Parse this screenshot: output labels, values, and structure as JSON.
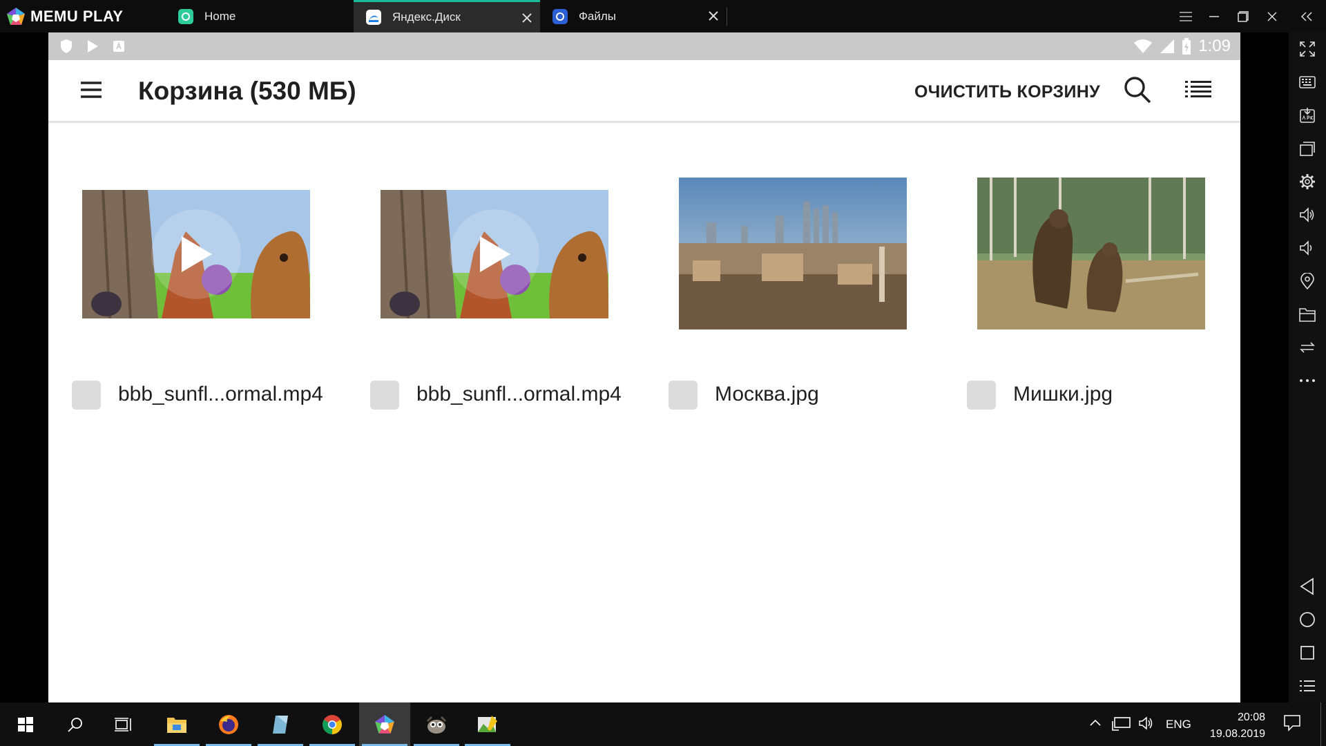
{
  "window": {
    "brand": "MEMU PLAY",
    "tabs": [
      {
        "label": "Home",
        "icon": "memu-home-icon"
      },
      {
        "label": "Яндекс.Диск",
        "icon": "yandex-disk-icon"
      },
      {
        "label": "Файлы",
        "icon": "files-icon"
      }
    ]
  },
  "android": {
    "time": "1:09"
  },
  "appbar": {
    "title": "Корзина (530 МБ)",
    "clear_label": "ОЧИСТИТЬ КОРЗИНУ"
  },
  "files": [
    {
      "name": "bbb_sunfl...ormal.mp4",
      "type": "video"
    },
    {
      "name": "bbb_sunfl...ormal.mp4",
      "type": "video"
    },
    {
      "name": "Москва.jpg",
      "type": "photo"
    },
    {
      "name": "Мишки.jpg",
      "type": "photo"
    }
  ],
  "taskbar": {
    "language": "ENG",
    "time": "20:08",
    "date": "19.08.2019"
  },
  "colors": {
    "accent": "#1abc9c",
    "statusbar": "#c9c9c9",
    "checkbox": "#dcdcdc"
  }
}
